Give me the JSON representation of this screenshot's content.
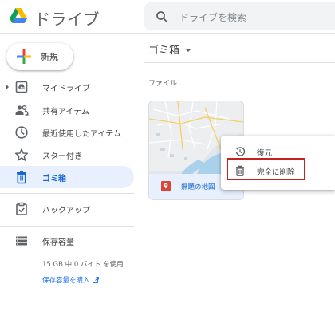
{
  "app": {
    "title": "ドライブ"
  },
  "search": {
    "placeholder": "ドライブを検索"
  },
  "sidebar": {
    "new_button": "新規",
    "items": [
      {
        "label": "マイドライブ",
        "icon": "my-drive-icon"
      },
      {
        "label": "共有アイテム",
        "icon": "shared-people-icon"
      },
      {
        "label": "最近使用したアイテム",
        "icon": "clock-icon"
      },
      {
        "label": "スター付き",
        "icon": "star-icon"
      },
      {
        "label": "ゴミ箱",
        "icon": "trash-icon",
        "active": true
      },
      {
        "label": "バックアップ",
        "icon": "backup-icon"
      },
      {
        "label": "保存容量",
        "icon": "storage-icon"
      }
    ],
    "storage_usage": "15 GB 中 0 バイト を使用",
    "buy_storage": "保存容量を購入"
  },
  "main": {
    "title": "ゴミ箱",
    "section_label": "ファイル",
    "files": [
      {
        "name": "無題の地図",
        "type_icon": "my-maps-icon"
      }
    ]
  },
  "context_menu": {
    "items": [
      {
        "label": "復元",
        "icon": "restore-icon"
      },
      {
        "label": "完全に削除",
        "icon": "delete-forever-icon",
        "highlighted": true
      }
    ]
  },
  "colors": {
    "accent": "#1a73e8",
    "active_bg": "#e8f0fe",
    "active_text": "#1967d2",
    "highlight_border": "#c5221f",
    "maps_red": "#db4437"
  }
}
